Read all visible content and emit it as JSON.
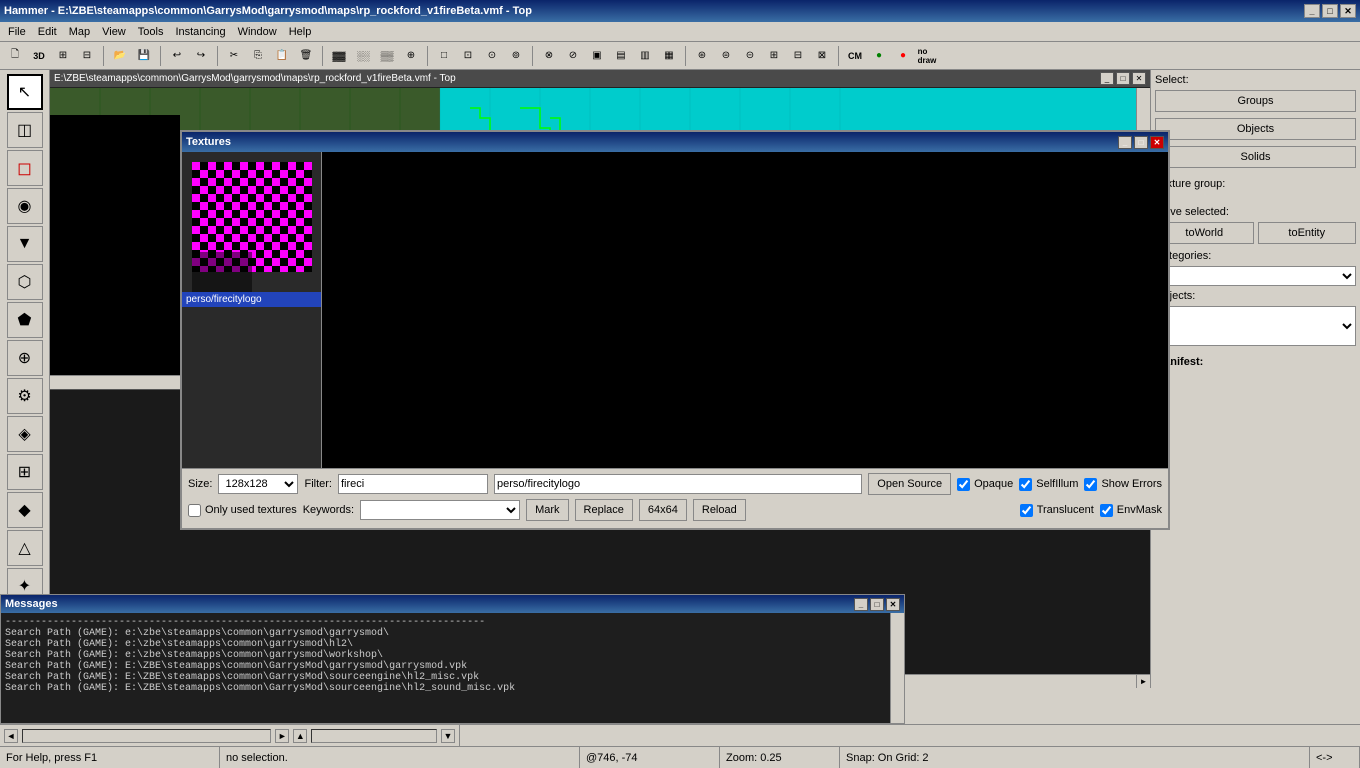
{
  "window": {
    "title": "Hammer - E:\\ZBE\\steamapps\\common\\GarrysMod\\garrysmod\\maps\\rp_rockford_v1fireBeta.vmf - Top",
    "minimize": "_",
    "maximize": "□",
    "close": "✕"
  },
  "menu": {
    "items": [
      "File",
      "Edit",
      "Map",
      "View",
      "Tools",
      "Instancing",
      "Window",
      "Help"
    ]
  },
  "viewport_top": {
    "path": "E:\\ZBE\\steamapps\\common\\GarrysMod\\garrysmod\\maps\\rp_rockford_v1fireBeta.vmf - Top",
    "minimize": "_",
    "maximize": "□",
    "close": "✕"
  },
  "select_panel": {
    "label": "Select:",
    "groups_btn": "Groups",
    "objects_btn": "Objects",
    "solids_btn": "Solids",
    "texture_group_label": "Texture group:"
  },
  "move_panel": {
    "label": "Move selected:",
    "to_world_btn": "toWorld",
    "to_entity_btn": "toEntity"
  },
  "categories_label": "Categories:",
  "objects_label": "Objects:",
  "manifest_label": "Manifest:",
  "texture_dialog": {
    "title": "Textures",
    "size_label": "Size:",
    "size_value": "128x128",
    "filter_label": "Filter:",
    "filter_value": "fireci",
    "texture_path": "perso/firecitylogo",
    "open_source_btn": "Open Source",
    "only_used_label": "Only used textures",
    "keywords_label": "Keywords:",
    "mark_btn": "Mark",
    "replace_btn": "Replace",
    "size64_btn": "64x64",
    "reload_btn": "Reload",
    "opaque_label": "Opaque",
    "selfillum_label": "SelfIllum",
    "show_errors_label": "Show Errors",
    "translucent_label": "Translucent",
    "envmask_label": "EnvMask",
    "checked_opaque": true,
    "checked_selfillum": true,
    "checked_show_errors": true,
    "checked_translucent": true,
    "checked_envmask": true,
    "checked_only_used": false
  },
  "messages": {
    "title": "Messages",
    "lines": [
      "--------------------------------------------------------------------------------",
      "Search Path (GAME): e:\\zbe\\steamapps\\common\\garrysmod\\garrysmod\\",
      "Search Path (GAME): e:\\zbe\\steamapps\\common\\garrysmod\\hl2\\",
      "Search Path (GAME): e:\\zbe\\steamapps\\common\\garrysmod\\workshop\\",
      "Search Path (GAME): E:\\ZBE\\steamapps\\common\\GarrysMod\\garrysmod\\garrysmod.vpk",
      "Search Path (GAME): E:\\ZBE\\steamapps\\common\\GarrysMod\\sourceengine\\hl2_misc.vpk",
      "Search Path (GAME): E:\\ZBE\\steamapps\\common\\GarrysMod\\sourceengine\\hl2_sound_misc.vpk"
    ]
  },
  "status_bar": {
    "help": "For Help, press F1",
    "selection": "no selection.",
    "coords": "@746, -74",
    "zoom": "Zoom: 0.25",
    "snap": "Snap: On Grid: 2",
    "arrows": "<->"
  },
  "tools": {
    "items": [
      "✏",
      "◫",
      "◻",
      "◉",
      "▼",
      "⬡",
      "⬟",
      "⊕",
      "⚙",
      "◈",
      "⊞",
      "◆",
      "△",
      "✦"
    ]
  }
}
